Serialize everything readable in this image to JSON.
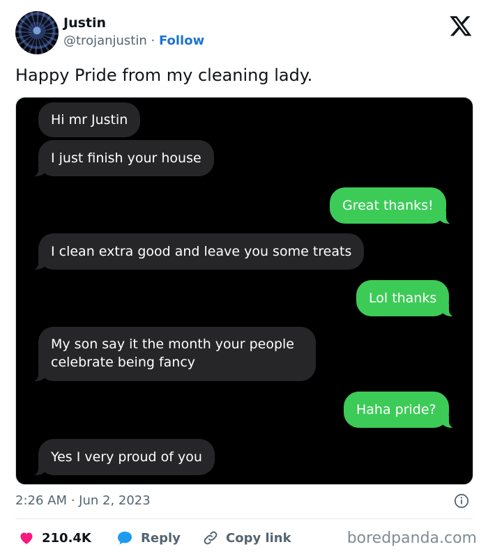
{
  "author": {
    "name": "Justin",
    "handle": "@trojanjustin",
    "separator": " · ",
    "follow_label": "Follow"
  },
  "tweet": {
    "text": "Happy Pride from my cleaning lady."
  },
  "messages": [
    {
      "from": "them",
      "text": "Hi mr Justin"
    },
    {
      "from": "them",
      "text": "I just finish your house"
    },
    {
      "from": "me",
      "text": "Great thanks!"
    },
    {
      "from": "them",
      "text": "I clean extra good and leave you some treats"
    },
    {
      "from": "me",
      "text": "Lol thanks"
    },
    {
      "from": "them",
      "text": "My son say it the month your people celebrate being fancy"
    },
    {
      "from": "me",
      "text": "Haha pride?"
    },
    {
      "from": "them",
      "text": "Yes I very proud of you"
    }
  ],
  "meta": {
    "timestamp": "2:26 AM · Jun 2, 2023"
  },
  "actions": {
    "likes": "210.4K",
    "reply_label": "Reply",
    "copy_link_label": "Copy link"
  },
  "watermark": "boredpanda.com",
  "colors": {
    "outgoing_bubble": "#3dcb58",
    "incoming_bubble": "#262628",
    "follow": "#1d74d1",
    "like": "#f91880",
    "reply": "#1d9bf0"
  },
  "icons": [
    "x-logo-icon",
    "info-icon",
    "heart-icon",
    "reply-bubble-icon",
    "link-icon"
  ]
}
